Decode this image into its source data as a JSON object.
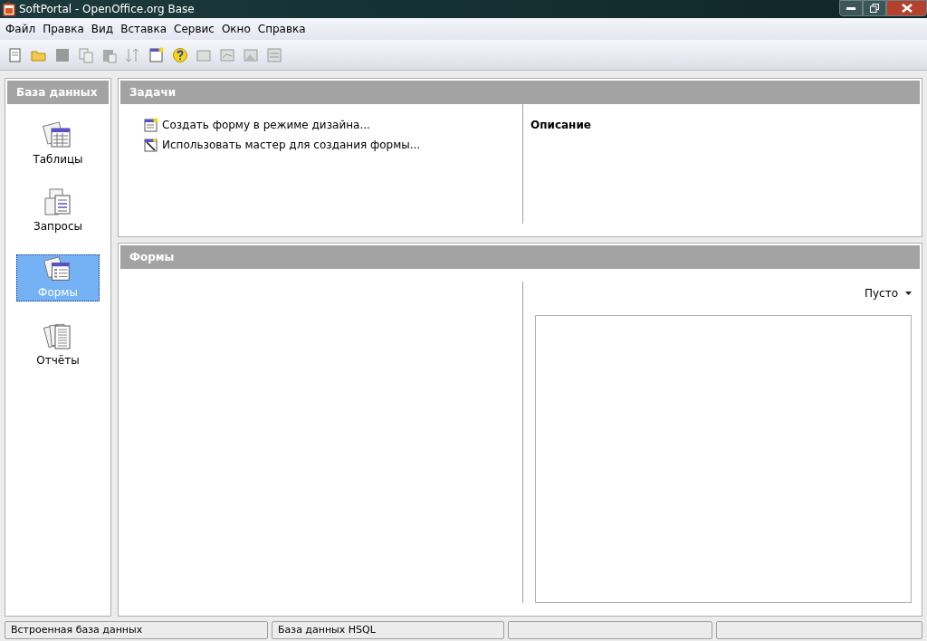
{
  "window": {
    "title": "SoftPortal - OpenOffice.org Base"
  },
  "menu": [
    "Файл",
    "Правка",
    "Вид",
    "Вставка",
    "Сервис",
    "Окно",
    "Справка"
  ],
  "sidebar": {
    "title": "База данных",
    "items": [
      {
        "label": "Таблицы",
        "kind": "table",
        "selected": false
      },
      {
        "label": "Запросы",
        "kind": "query",
        "selected": false
      },
      {
        "label": "Формы",
        "kind": "form",
        "selected": true
      },
      {
        "label": "Отчёты",
        "kind": "report",
        "selected": false
      }
    ]
  },
  "tasks": {
    "title": "Задачи",
    "items": [
      {
        "label": "Создать форму в режиме дизайна...",
        "kind": "design"
      },
      {
        "label": "Использовать мастер для создания формы...",
        "kind": "wizard"
      }
    ],
    "description_title": "Описание"
  },
  "forms": {
    "title": "Формы",
    "preview_mode": "Пусто"
  },
  "status_bar": [
    "Встроенная база данных",
    "База данных HSQL"
  ]
}
